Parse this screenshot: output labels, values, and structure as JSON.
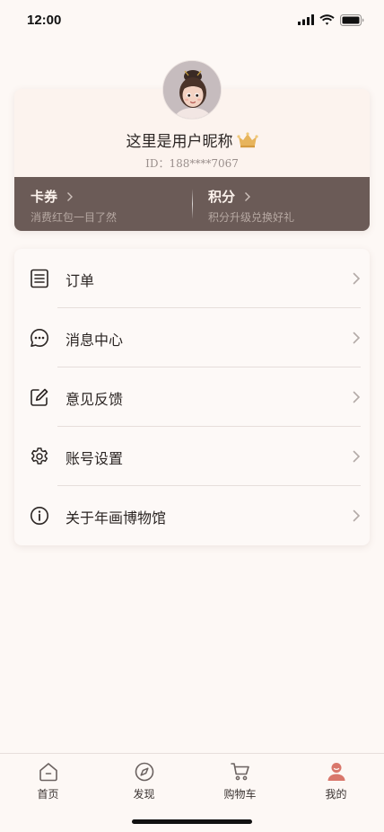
{
  "status_bar": {
    "time": "12:00",
    "icons": [
      "signal-icon",
      "wifi-icon",
      "battery-icon"
    ]
  },
  "profile": {
    "nickname": "这里是用户昵称",
    "user_id": "ID：188****7067",
    "crown_icon": "crown-icon",
    "benefits": [
      {
        "title": "卡券",
        "subtitle": "消费红包一目了然"
      },
      {
        "title": "积分",
        "subtitle": "积分升级兑换好礼"
      }
    ]
  },
  "menu": {
    "items": [
      {
        "label": "订单",
        "icon": "order-list-icon"
      },
      {
        "label": "消息中心",
        "icon": "message-icon"
      },
      {
        "label": "意见反馈",
        "icon": "feedback-edit-icon"
      },
      {
        "label": "账号设置",
        "icon": "settings-gear-icon"
      },
      {
        "label": "关于年画博物馆",
        "icon": "info-icon"
      }
    ]
  },
  "tab_bar": {
    "items": [
      {
        "label": "首页",
        "icon": "home-icon"
      },
      {
        "label": "发现",
        "icon": "compass-icon"
      },
      {
        "label": "购物车",
        "icon": "cart-icon"
      },
      {
        "label": "我的",
        "icon": "user-icon",
        "active": true
      }
    ]
  },
  "colors": {
    "background": "#fdf8f5",
    "benefit_bar": "#6b5b57",
    "active_tab": "#d9776b",
    "crown": "#e7b45c"
  }
}
